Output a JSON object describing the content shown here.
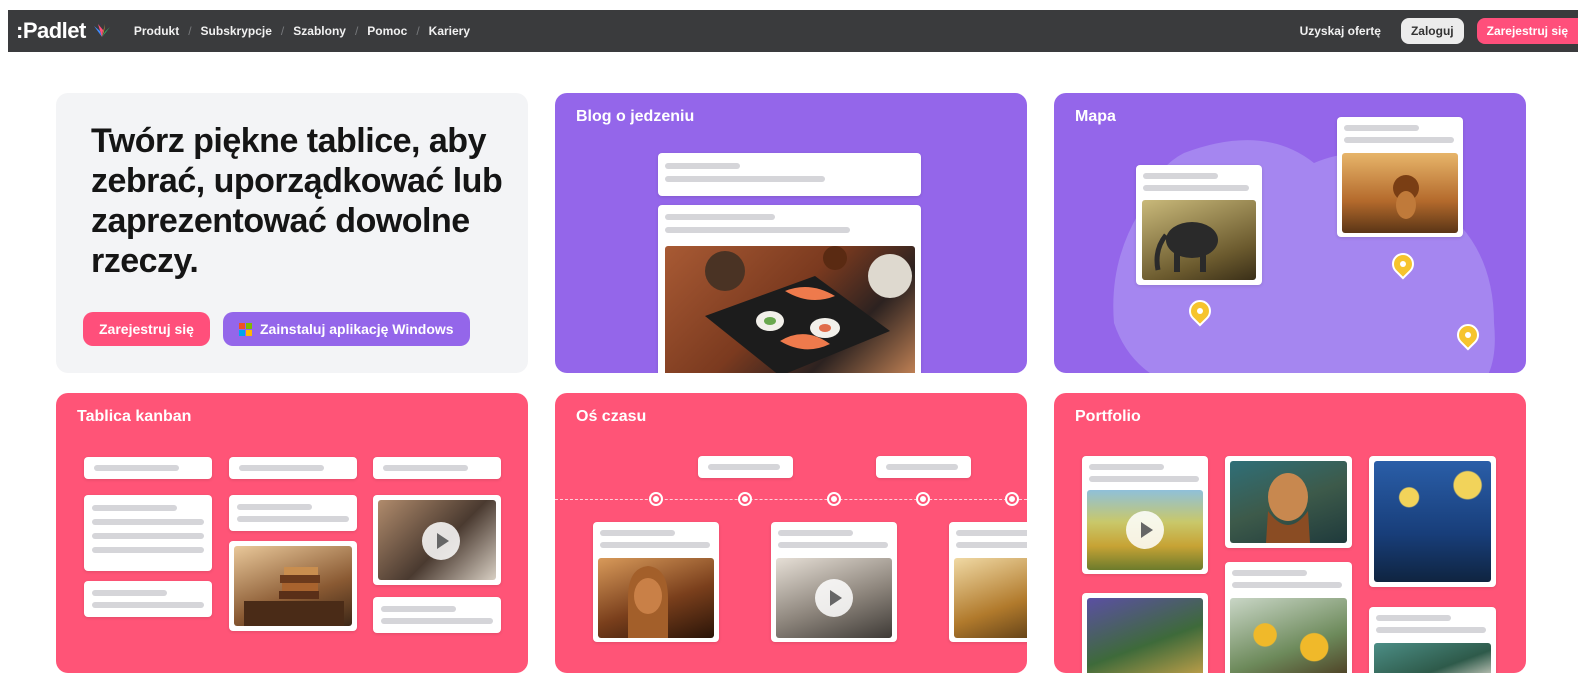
{
  "nav": {
    "logo": ":Padlet",
    "links": [
      "Produkt",
      "Subskrypcje",
      "Szablony",
      "Pomoc",
      "Kariery"
    ],
    "offer": "Uzyskaj ofertę",
    "login": "Zaloguj",
    "signup": "Zarejestruj się"
  },
  "hero": {
    "title": "Twórz piękne tablice, aby zebrać, uporządkować lub zaprezentować dowolne rzeczy.",
    "signup_button": "Zarejestruj się",
    "install_button": "Zainstaluj aplikację Windows"
  },
  "cards": {
    "food_blog": "Blog o jedzeniu",
    "map": "Mapa",
    "kanban": "Tablica kanban",
    "timeline": "Oś czasu",
    "portfolio": "Portfolio"
  },
  "colors": {
    "nav_bg": "#3a3b3d",
    "purple": "#9466ea",
    "pink": "#ff5477",
    "brand_pink": "#ff4f7b",
    "pin_yellow": "#f6c42d"
  }
}
